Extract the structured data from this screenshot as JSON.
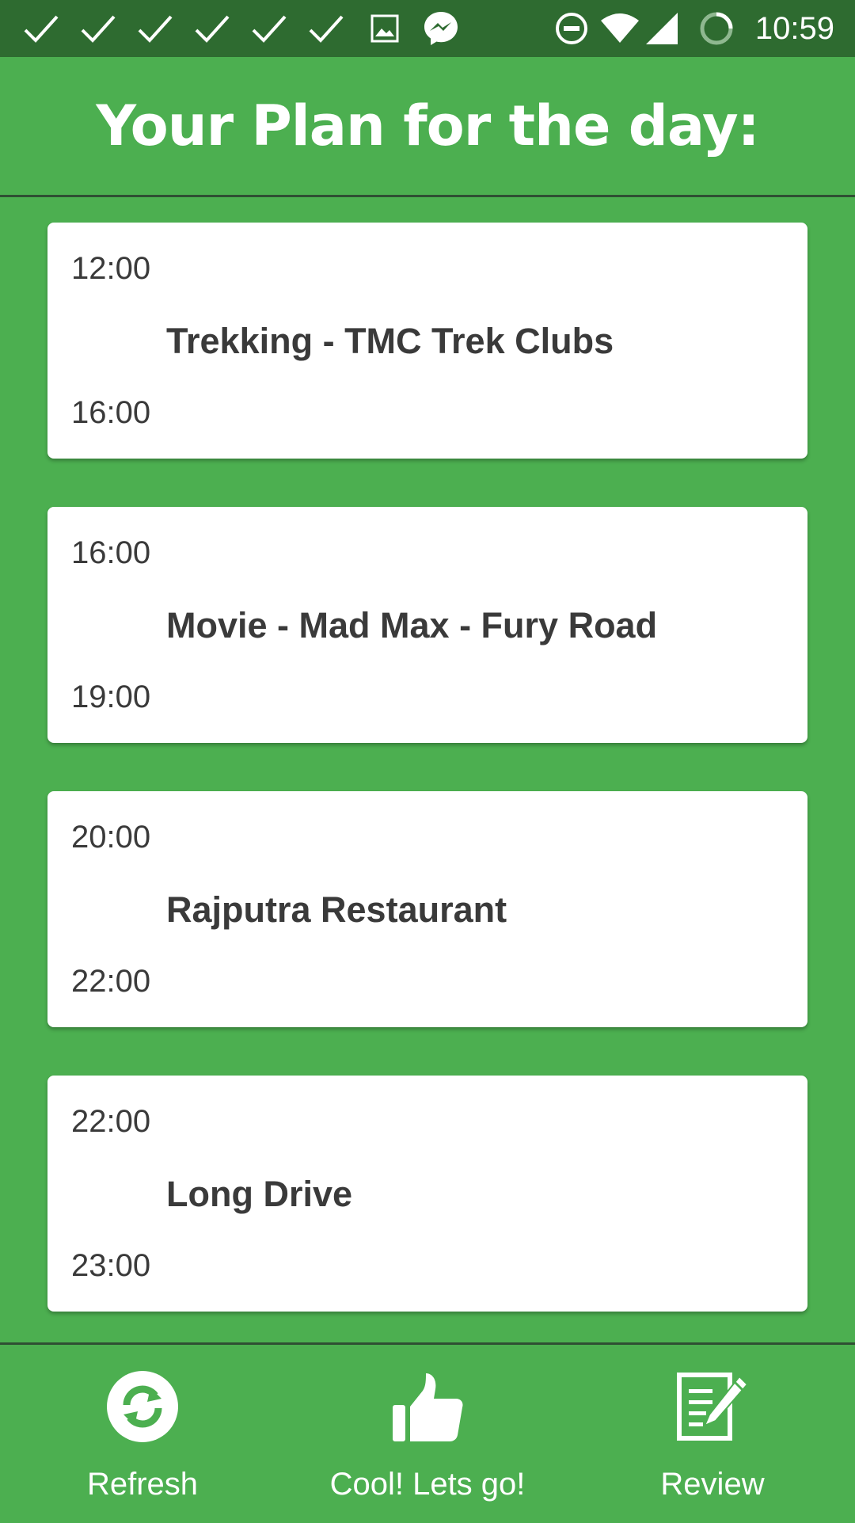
{
  "status_bar": {
    "time": "10:59",
    "notification_icons": [
      "check-icon",
      "check-icon",
      "check-icon",
      "check-icon",
      "check-icon",
      "check-icon",
      "image-icon",
      "messenger-icon"
    ],
    "system_icons": [
      "do-not-disturb-icon",
      "wifi-icon",
      "signal-icon",
      "battery-charging-icon"
    ]
  },
  "header": {
    "title": "Your Plan for the day:"
  },
  "plan": {
    "items": [
      {
        "start": "12:00",
        "title": "Trekking - TMC Trek Clubs",
        "end": "16:00"
      },
      {
        "start": "16:00",
        "title": "Movie - Mad Max - Fury Road",
        "end": "19:00"
      },
      {
        "start": "20:00",
        "title": "Rajputra Restaurant",
        "end": "22:00"
      },
      {
        "start": "22:00",
        "title": "Long Drive",
        "end": "23:00"
      }
    ]
  },
  "actions": {
    "refresh": {
      "label": "Refresh",
      "icon": "refresh-icon"
    },
    "confirm": {
      "label": "Cool! Lets go!",
      "icon": "thumbs-up-icon"
    },
    "review": {
      "label": "Review",
      "icon": "edit-icon"
    }
  },
  "colors": {
    "background": "#4caf50",
    "status_bar": "#2e6b30",
    "card": "#ffffff",
    "card_text": "#3a3a3a",
    "divider": "#2f4f33"
  }
}
